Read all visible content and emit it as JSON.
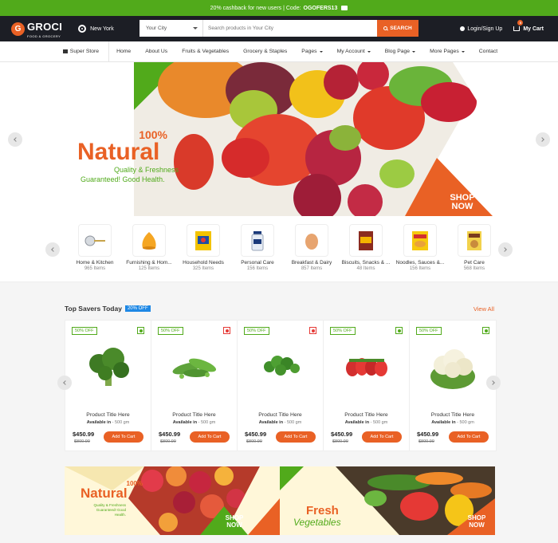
{
  "promo": {
    "text": "20% cashback for new users | Code:",
    "code": "OGOFERS13"
  },
  "header": {
    "logo": "GROCI",
    "logo_letter": "G",
    "logo_sub": "FOOD & GROCERY",
    "location": "New York",
    "city_select": "Your City",
    "search_placeholder": "Search products in Your City",
    "search_button": "SEARCH",
    "login": "Login/Sign Up",
    "cart_label": "My Cart",
    "cart_count": "5"
  },
  "nav": {
    "store": "Super Store",
    "items": [
      "Home",
      "About Us",
      "Fruits & Vegetables",
      "Grocery & Staples",
      "Pages",
      "My Account",
      "Blog Page",
      "More Pages",
      "Contact"
    ]
  },
  "hero": {
    "percent": "100%",
    "headline": "Natural",
    "sub1": "Quality & Freshness",
    "sub2": "Guaranteed! Good Health.",
    "shop_line1": "SHOP",
    "shop_line2": "NOW"
  },
  "categories": [
    {
      "name": "Home & Kitchen",
      "count": "965 Items",
      "icon": "kitchen-tool"
    },
    {
      "name": "Furnishing & Hom...",
      "count": "125 Items",
      "icon": "bean-bag"
    },
    {
      "name": "Household Needs",
      "count": "325 Items",
      "icon": "detergent-pack"
    },
    {
      "name": "Personal Care",
      "count": "156 Items",
      "icon": "cream-tube"
    },
    {
      "name": "Breakfast & Dairy",
      "count": "857 Items",
      "icon": "egg"
    },
    {
      "name": "Biscuits, Snacks & ...",
      "count": "48 Items",
      "icon": "snack-pack"
    },
    {
      "name": "Noodles, Sauces &...",
      "count": "156 Items",
      "icon": "noodle-pack"
    },
    {
      "name": "Pet Care",
      "count": "568 Items",
      "icon": "pet-food"
    }
  ],
  "savers": {
    "title": "Top Savers Today",
    "badge": "20% OFF",
    "view_all": "View All"
  },
  "products": [
    {
      "badge": "50% OFF",
      "type": "veg",
      "title": "Product Title Here",
      "avail_label": "Available in",
      "avail_qty": "- 500 gm",
      "price": "$450.99",
      "old_price": "$800.99",
      "button": "Add To Cart",
      "image": "broccoli"
    },
    {
      "badge": "50% OFF",
      "type": "nonveg",
      "title": "Product Title Here",
      "avail_label": "Available in",
      "avail_qty": "- 500 gm",
      "price": "$450.99",
      "old_price": "$800.99",
      "button": "Add To Cart",
      "image": "green-peas"
    },
    {
      "badge": "50% OFF",
      "type": "nonveg",
      "title": "Product Title Here",
      "avail_label": "Available in",
      "avail_qty": "- 500 gm",
      "price": "$450.99",
      "old_price": "$800.99",
      "button": "Add To Cart",
      "image": "coriander"
    },
    {
      "badge": "50% OFF",
      "type": "veg",
      "title": "Product Title Here",
      "avail_label": "Available in",
      "avail_qty": "- 500 gm",
      "price": "$450.99",
      "old_price": "$800.99",
      "button": "Add To Cart",
      "image": "strawberries"
    },
    {
      "badge": "50% OFF",
      "type": "veg",
      "title": "Product Title Here",
      "avail_label": "Available in",
      "avail_qty": "- 500 gm",
      "price": "$450.99",
      "old_price": "$800.99",
      "button": "Add To Cart",
      "image": "cauliflower"
    }
  ],
  "banners": [
    {
      "percent": "100%",
      "headline": "Natural",
      "sub": "Quality & Freshness Guaranteed! Good Health.",
      "shop_line1": "SHOP",
      "shop_line2": "NOW"
    },
    {
      "headline": "Fresh",
      "sub": "Vegetables",
      "shop_line1": "SHOP",
      "shop_line2": "NOW"
    }
  ],
  "colors": {
    "green": "#51aa1b",
    "orange": "#e96125",
    "dark": "#1c1e25",
    "blue": "#1e88e5"
  }
}
